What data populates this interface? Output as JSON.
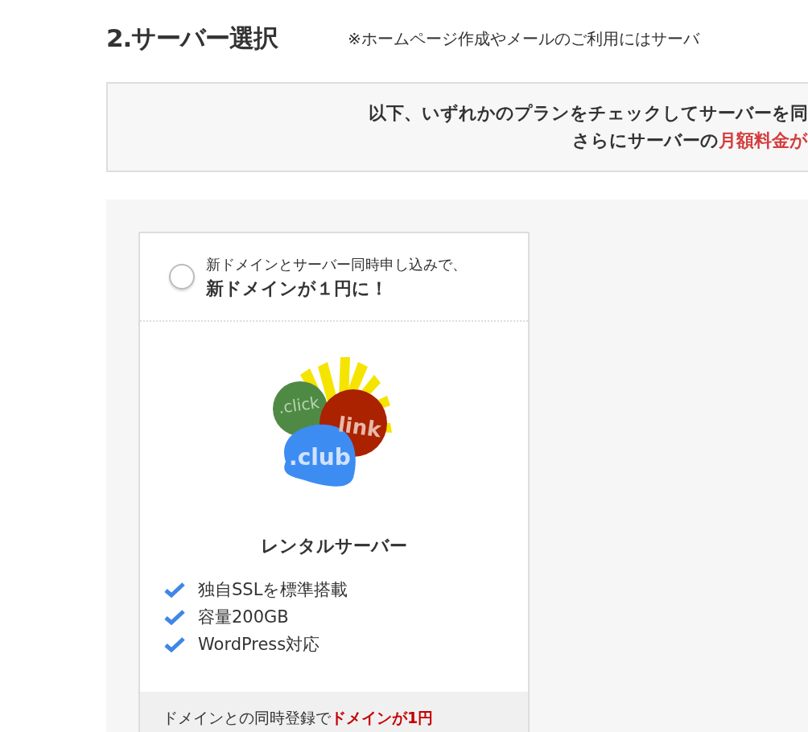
{
  "section": {
    "title": "2.サーバー選択",
    "note": "※ホームページ作成やメールのご利用にはサーバ"
  },
  "notice": {
    "line_1": "以下、いずれかのプランをチェックしてサーバーを同",
    "line_2": "さらにサーバーの",
    "line_2_highlight": "月額料金が"
  },
  "plan": {
    "selected": false,
    "offer_line_1": "新ドメインとサーバー同時申し込みで、",
    "offer_line_2": "新ドメインが１円に！",
    "logo_labels": [
      ".click",
      "link",
      ".club"
    ],
    "name": "レンタルサーバー",
    "features": [
      "独自SSLを標準搭載",
      "容量200GB",
      "WordPress対応"
    ],
    "footer": "ドメインとの同時登録で",
    "footer_highlight": "ドメインが1円"
  }
}
